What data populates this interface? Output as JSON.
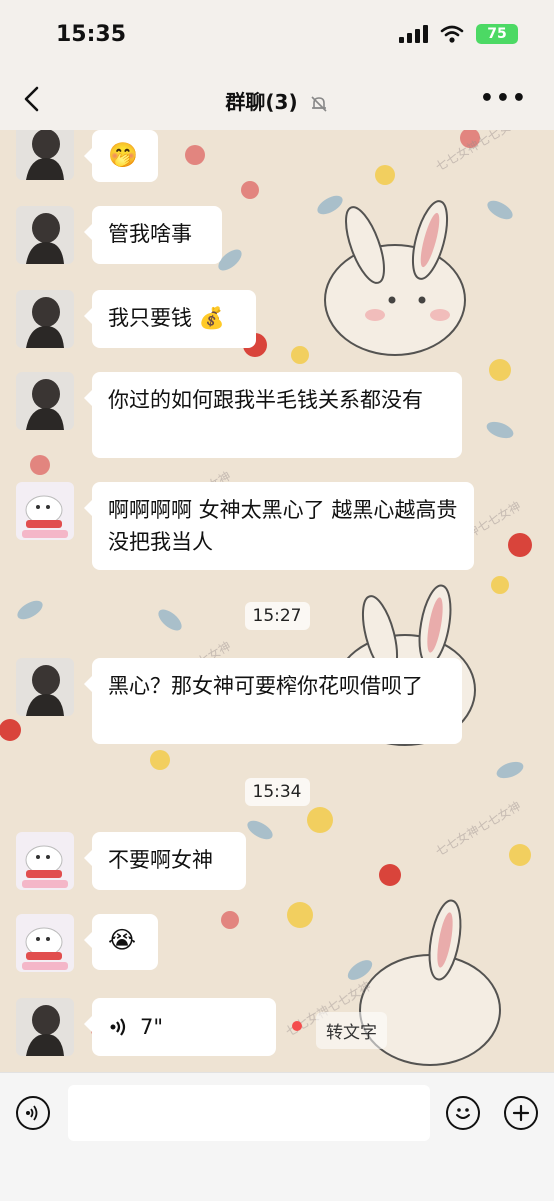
{
  "status_bar": {
    "time": "15:35",
    "battery": "75"
  },
  "nav": {
    "title": "群聊(3)",
    "back_icon": "chevron-left-icon",
    "more_icon": "more-icon",
    "mute_icon": "bell-off-icon"
  },
  "messages": [
    {
      "sender": "user-a",
      "text": "🤭"
    },
    {
      "sender": "user-a",
      "text": "管我啥事"
    },
    {
      "sender": "user-a",
      "text": "我只要钱 💰"
    },
    {
      "sender": "user-a",
      "text": "你过的如何跟我半毛钱关系都没有"
    },
    {
      "sender": "user-b",
      "text": "啊啊啊啊 女神太黑心了 越黑心越高贵  没把我当人"
    },
    {
      "sender": "user-a",
      "text": "黑心？那女神可要榨你花呗借呗了"
    },
    {
      "sender": "user-b",
      "text": "不要啊女神"
    },
    {
      "sender": "user-b",
      "text": "😭"
    },
    {
      "sender": "user-a",
      "voice_duration": "7\"",
      "to_text_label": "转文字"
    }
  ],
  "timestamps": [
    "15:27",
    "15:34"
  ],
  "watermark_text": "七七女神七七女神",
  "input_bar": {
    "voice_icon": "voice-icon",
    "emoji_icon": "emoji-icon",
    "plus_icon": "plus-icon"
  },
  "colors": {
    "accent_battery": "#4cd964",
    "unread_dot": "#f44d4d",
    "bubble": "#ffffff"
  }
}
